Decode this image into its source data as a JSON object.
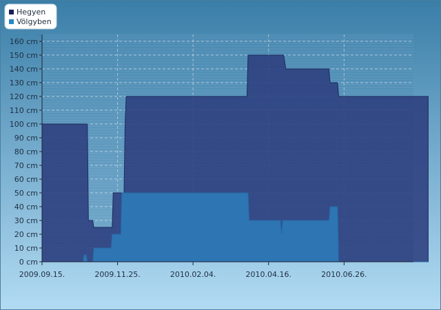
{
  "chart_data": {
    "type": "area",
    "title": "",
    "xlabel": "",
    "ylabel": "",
    "x_ticks": [
      "2009.09.15.",
      "2009.11.25.",
      "2010.02.04.",
      "2010.04.16.",
      "2010.06.26."
    ],
    "y_ticks": [
      "0 cm",
      "10 cm",
      "20 cm",
      "30 cm",
      "40 cm",
      "50 cm",
      "60 cm",
      "70 cm",
      "80 cm",
      "90 cm",
      "100 cm",
      "110 cm",
      "120 cm",
      "130 cm",
      "140 cm",
      "150 cm",
      "160 cm"
    ],
    "ylim": [
      0,
      160
    ],
    "xlim": [
      "2009-09-15",
      "2010-09-08"
    ],
    "grid": true,
    "legend_position": "top-left",
    "series": [
      {
        "name": "Hegyen",
        "color": "#2c3f7e",
        "points": [
          [
            "2009-09-15",
            100
          ],
          [
            "2009-10-27",
            100
          ],
          [
            "2009-10-28",
            30
          ],
          [
            "2009-11-01",
            30
          ],
          [
            "2009-11-02",
            25
          ],
          [
            "2009-11-19",
            25
          ],
          [
            "2009-11-20",
            50
          ],
          [
            "2009-11-30",
            50
          ],
          [
            "2009-12-01",
            100
          ],
          [
            "2009-12-02",
            120
          ],
          [
            "2010-03-24",
            120
          ],
          [
            "2010-03-25",
            150
          ],
          [
            "2010-04-27",
            150
          ],
          [
            "2010-04-29",
            140
          ],
          [
            "2010-06-08",
            140
          ],
          [
            "2010-06-09",
            130
          ],
          [
            "2010-06-16",
            130
          ],
          [
            "2010-06-17",
            120
          ],
          [
            "2010-09-08",
            120
          ]
        ]
      },
      {
        "name": "Völgyben",
        "color": "#2e78b6",
        "points": [
          [
            "2009-09-15",
            0
          ],
          [
            "2009-10-23",
            0
          ],
          [
            "2009-10-24",
            5
          ],
          [
            "2009-10-26",
            5
          ],
          [
            "2009-10-27",
            0
          ],
          [
            "2009-11-01",
            0
          ],
          [
            "2009-11-02",
            10
          ],
          [
            "2009-11-18",
            10
          ],
          [
            "2009-11-19",
            20
          ],
          [
            "2009-11-27",
            20
          ],
          [
            "2009-11-28",
            50
          ],
          [
            "2010-03-25",
            50
          ],
          [
            "2010-03-26",
            30
          ],
          [
            "2010-04-24",
            30
          ],
          [
            "2010-04-25",
            20
          ],
          [
            "2010-04-26",
            30
          ],
          [
            "2010-06-08",
            30
          ],
          [
            "2010-06-09",
            40
          ],
          [
            "2010-06-16",
            40
          ],
          [
            "2010-06-17",
            0
          ],
          [
            "2010-09-08",
            0
          ]
        ]
      }
    ]
  }
}
